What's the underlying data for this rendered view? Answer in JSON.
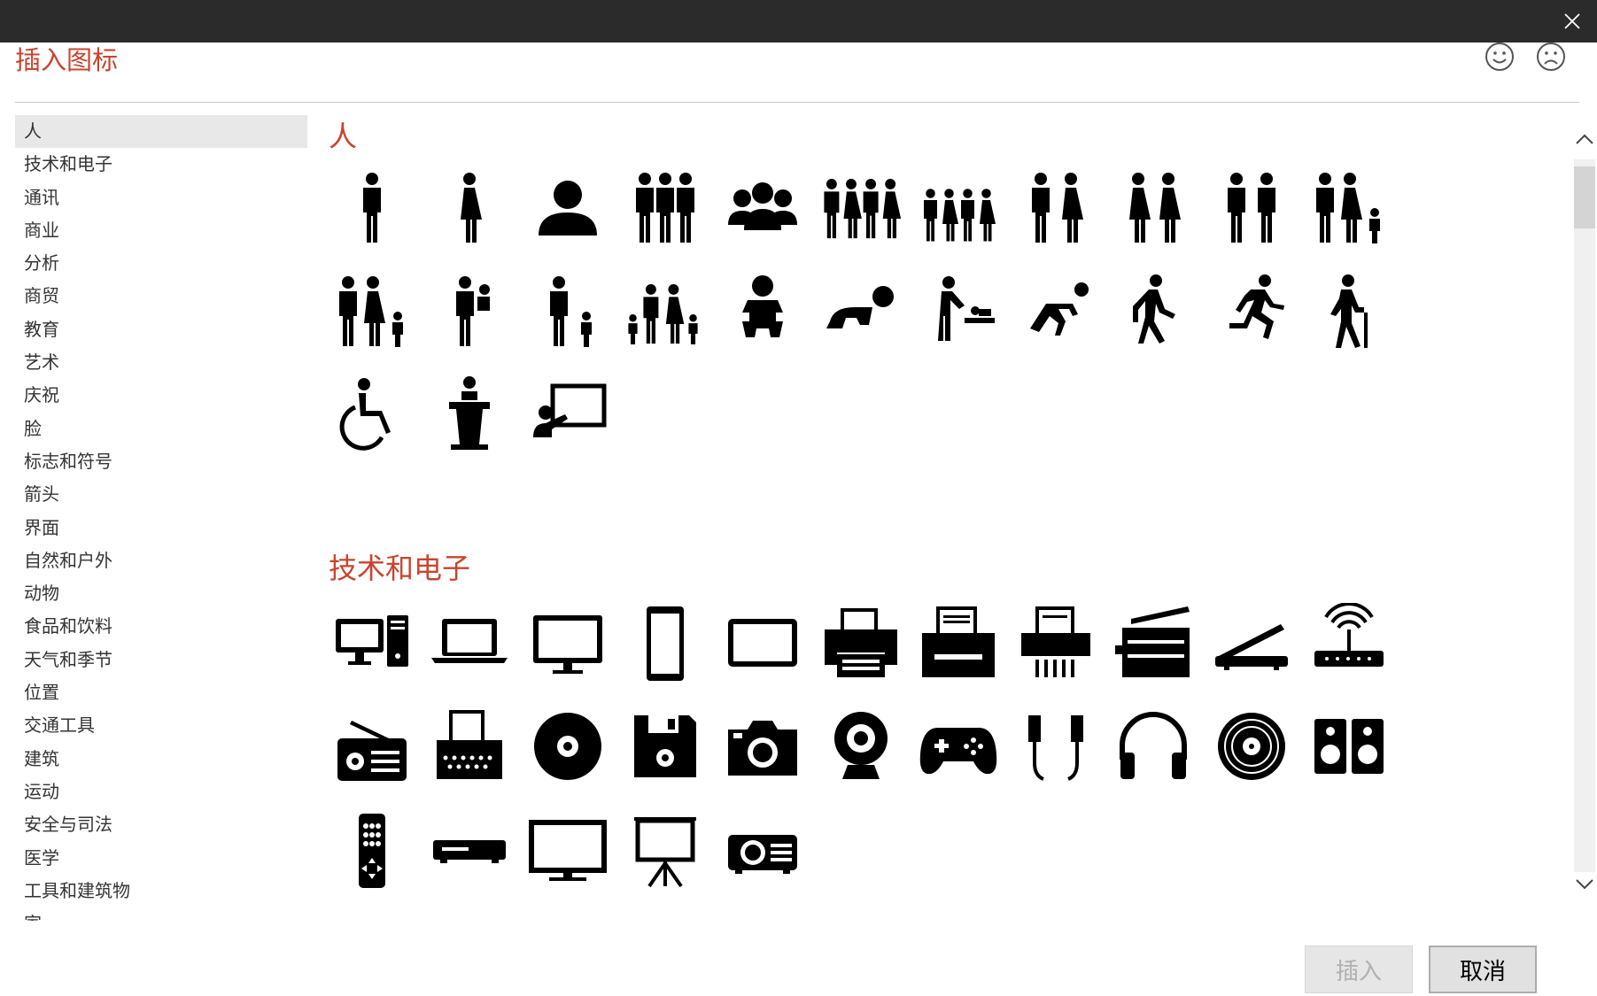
{
  "dialog": {
    "title": "插入图标",
    "feedback": {
      "smile_icon": "smile-icon",
      "frown_icon": "frown-icon"
    },
    "close_icon": "close-icon"
  },
  "sidebar": {
    "selected_index": 0,
    "categories": [
      "人",
      "技术和电子",
      "通讯",
      "商业",
      "分析",
      "商贸",
      "教育",
      "艺术",
      "庆祝",
      "脸",
      "标志和符号",
      "箭头",
      "界面",
      "自然和户外",
      "动物",
      "食品和饮料",
      "天气和季节",
      "位置",
      "交通工具",
      "建筑",
      "运动",
      "安全与司法",
      "医学",
      "工具和建筑物",
      "家"
    ]
  },
  "sections": [
    {
      "title": "人",
      "icons": [
        "man",
        "woman",
        "user",
        "group",
        "user-group",
        "people-four",
        "children-four",
        "man-and-woman",
        "two-women",
        "two-men",
        "family-with-child",
        "family-four",
        "man-holding-baby",
        "man-with-child",
        "family-kids",
        "baby",
        "crawling-baby",
        "baby-changing",
        "crawling-person",
        "walking-person",
        "running-person",
        "elderly-with-cane",
        "wheelchair",
        "speaker-at-podium",
        "presenter-at-board"
      ]
    },
    {
      "title": "技术和电子",
      "icons": [
        "desktop-computer",
        "laptop",
        "monitor",
        "smartphone",
        "tablet",
        "printer",
        "fax-printer",
        "shredder",
        "copier",
        "scanner",
        "wifi-router",
        "radio",
        "typewriter",
        "disc",
        "floppy-disk",
        "camera",
        "webcam",
        "game-controller",
        "earbuds",
        "headphones",
        "vinyl-record",
        "speakers",
        "remote-control",
        "dvd-player",
        "tv",
        "projector-screen",
        "projector"
      ]
    }
  ],
  "buttons": {
    "insert": "插入",
    "cancel": "取消",
    "insert_disabled": true
  },
  "colors": {
    "accent": "#c8442f",
    "titlebar": "#2b2b2b",
    "selected_bg": "#e8e8e8"
  }
}
